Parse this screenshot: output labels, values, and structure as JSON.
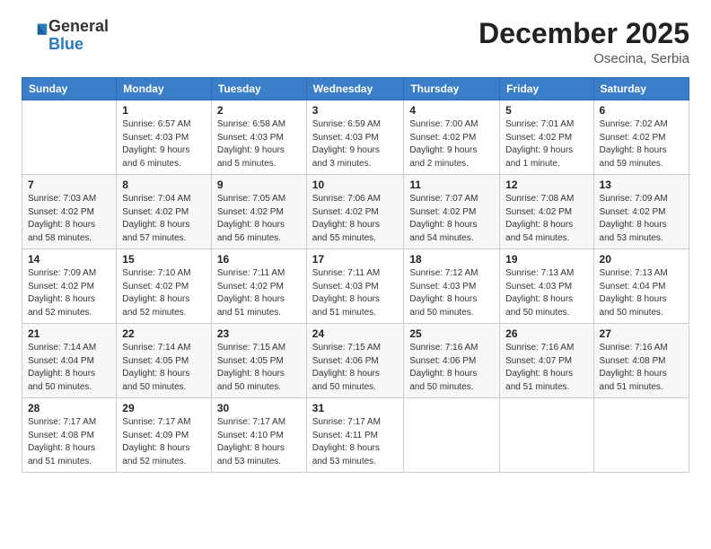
{
  "header": {
    "logo_general": "General",
    "logo_blue": "Blue",
    "title": "December 2025",
    "location": "Osecina, Serbia"
  },
  "weekdays": [
    "Sunday",
    "Monday",
    "Tuesday",
    "Wednesday",
    "Thursday",
    "Friday",
    "Saturday"
  ],
  "weeks": [
    [
      {
        "day": "",
        "info": ""
      },
      {
        "day": "1",
        "info": "Sunrise: 6:57 AM\nSunset: 4:03 PM\nDaylight: 9 hours\nand 6 minutes."
      },
      {
        "day": "2",
        "info": "Sunrise: 6:58 AM\nSunset: 4:03 PM\nDaylight: 9 hours\nand 5 minutes."
      },
      {
        "day": "3",
        "info": "Sunrise: 6:59 AM\nSunset: 4:03 PM\nDaylight: 9 hours\nand 3 minutes."
      },
      {
        "day": "4",
        "info": "Sunrise: 7:00 AM\nSunset: 4:02 PM\nDaylight: 9 hours\nand 2 minutes."
      },
      {
        "day": "5",
        "info": "Sunrise: 7:01 AM\nSunset: 4:02 PM\nDaylight: 9 hours\nand 1 minute."
      },
      {
        "day": "6",
        "info": "Sunrise: 7:02 AM\nSunset: 4:02 PM\nDaylight: 8 hours\nand 59 minutes."
      }
    ],
    [
      {
        "day": "7",
        "info": "Sunrise: 7:03 AM\nSunset: 4:02 PM\nDaylight: 8 hours\nand 58 minutes."
      },
      {
        "day": "8",
        "info": "Sunrise: 7:04 AM\nSunset: 4:02 PM\nDaylight: 8 hours\nand 57 minutes."
      },
      {
        "day": "9",
        "info": "Sunrise: 7:05 AM\nSunset: 4:02 PM\nDaylight: 8 hours\nand 56 minutes."
      },
      {
        "day": "10",
        "info": "Sunrise: 7:06 AM\nSunset: 4:02 PM\nDaylight: 8 hours\nand 55 minutes."
      },
      {
        "day": "11",
        "info": "Sunrise: 7:07 AM\nSunset: 4:02 PM\nDaylight: 8 hours\nand 54 minutes."
      },
      {
        "day": "12",
        "info": "Sunrise: 7:08 AM\nSunset: 4:02 PM\nDaylight: 8 hours\nand 54 minutes."
      },
      {
        "day": "13",
        "info": "Sunrise: 7:09 AM\nSunset: 4:02 PM\nDaylight: 8 hours\nand 53 minutes."
      }
    ],
    [
      {
        "day": "14",
        "info": "Sunrise: 7:09 AM\nSunset: 4:02 PM\nDaylight: 8 hours\nand 52 minutes."
      },
      {
        "day": "15",
        "info": "Sunrise: 7:10 AM\nSunset: 4:02 PM\nDaylight: 8 hours\nand 52 minutes."
      },
      {
        "day": "16",
        "info": "Sunrise: 7:11 AM\nSunset: 4:02 PM\nDaylight: 8 hours\nand 51 minutes."
      },
      {
        "day": "17",
        "info": "Sunrise: 7:11 AM\nSunset: 4:03 PM\nDaylight: 8 hours\nand 51 minutes."
      },
      {
        "day": "18",
        "info": "Sunrise: 7:12 AM\nSunset: 4:03 PM\nDaylight: 8 hours\nand 50 minutes."
      },
      {
        "day": "19",
        "info": "Sunrise: 7:13 AM\nSunset: 4:03 PM\nDaylight: 8 hours\nand 50 minutes."
      },
      {
        "day": "20",
        "info": "Sunrise: 7:13 AM\nSunset: 4:04 PM\nDaylight: 8 hours\nand 50 minutes."
      }
    ],
    [
      {
        "day": "21",
        "info": "Sunrise: 7:14 AM\nSunset: 4:04 PM\nDaylight: 8 hours\nand 50 minutes."
      },
      {
        "day": "22",
        "info": "Sunrise: 7:14 AM\nSunset: 4:05 PM\nDaylight: 8 hours\nand 50 minutes."
      },
      {
        "day": "23",
        "info": "Sunrise: 7:15 AM\nSunset: 4:05 PM\nDaylight: 8 hours\nand 50 minutes."
      },
      {
        "day": "24",
        "info": "Sunrise: 7:15 AM\nSunset: 4:06 PM\nDaylight: 8 hours\nand 50 minutes."
      },
      {
        "day": "25",
        "info": "Sunrise: 7:16 AM\nSunset: 4:06 PM\nDaylight: 8 hours\nand 50 minutes."
      },
      {
        "day": "26",
        "info": "Sunrise: 7:16 AM\nSunset: 4:07 PM\nDaylight: 8 hours\nand 51 minutes."
      },
      {
        "day": "27",
        "info": "Sunrise: 7:16 AM\nSunset: 4:08 PM\nDaylight: 8 hours\nand 51 minutes."
      }
    ],
    [
      {
        "day": "28",
        "info": "Sunrise: 7:17 AM\nSunset: 4:08 PM\nDaylight: 8 hours\nand 51 minutes."
      },
      {
        "day": "29",
        "info": "Sunrise: 7:17 AM\nSunset: 4:09 PM\nDaylight: 8 hours\nand 52 minutes."
      },
      {
        "day": "30",
        "info": "Sunrise: 7:17 AM\nSunset: 4:10 PM\nDaylight: 8 hours\nand 53 minutes."
      },
      {
        "day": "31",
        "info": "Sunrise: 7:17 AM\nSunset: 4:11 PM\nDaylight: 8 hours\nand 53 minutes."
      },
      {
        "day": "",
        "info": ""
      },
      {
        "day": "",
        "info": ""
      },
      {
        "day": "",
        "info": ""
      }
    ]
  ]
}
